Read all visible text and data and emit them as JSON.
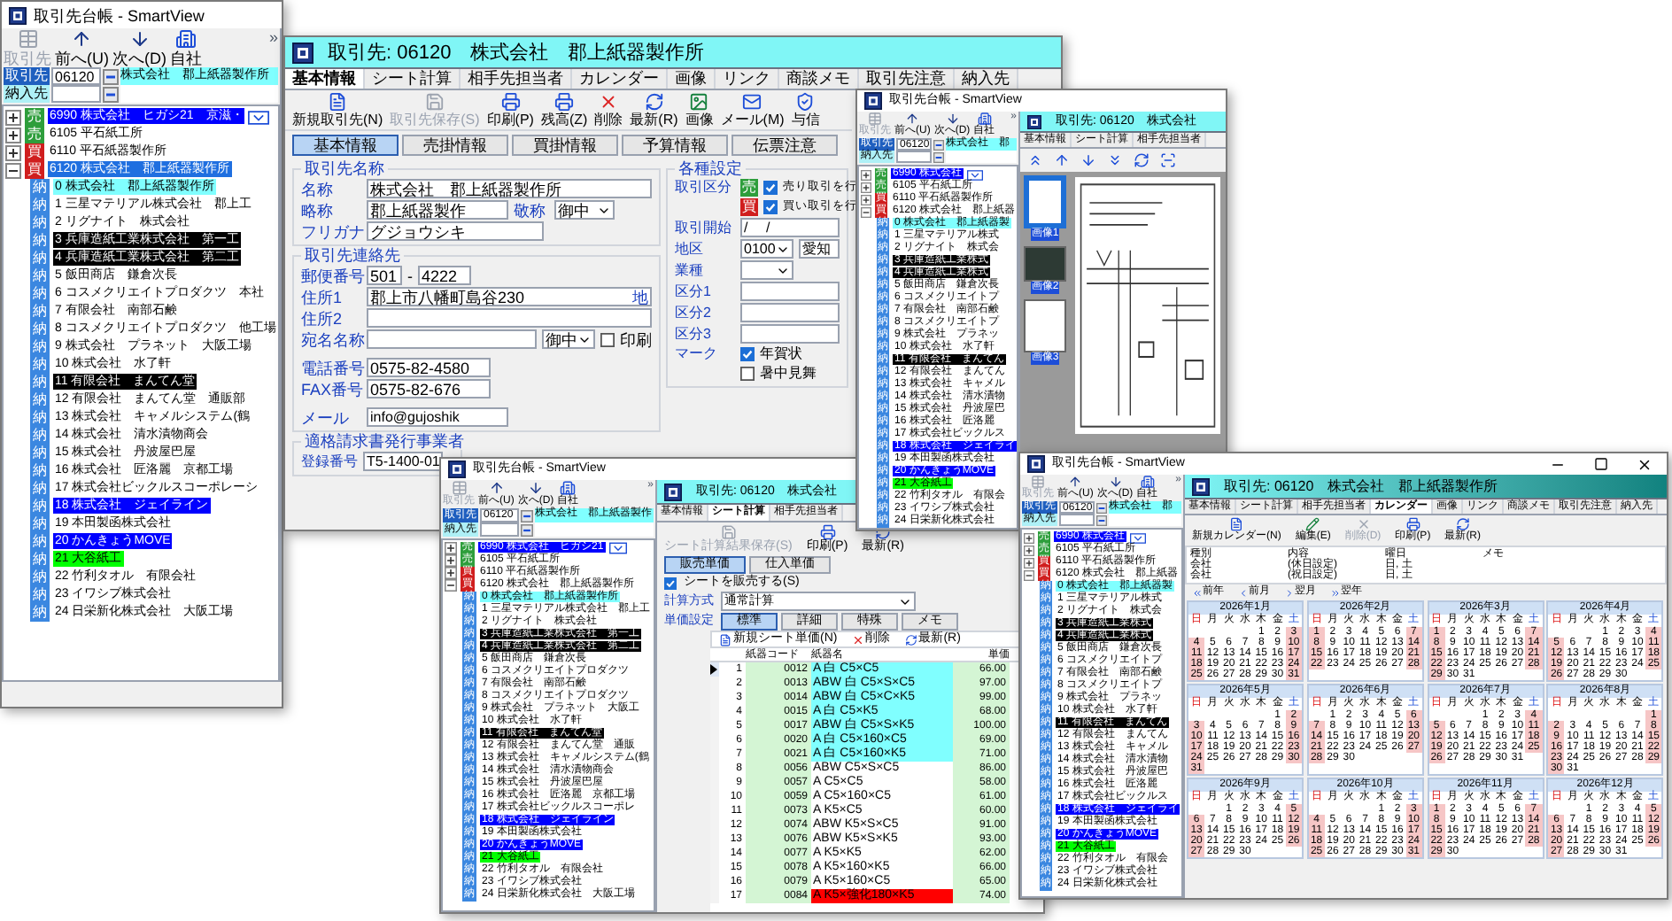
{
  "w1": {
    "title": "取引先台帳 - SmartView",
    "toolbar": [
      {
        "kind": "list",
        "label": "取引先",
        "disabled": true
      },
      {
        "kind": "up",
        "label": "前へ(U)",
        "disabled": false
      },
      {
        "kind": "down",
        "label": "次へ(D)",
        "disabled": false
      },
      {
        "kind": "company",
        "label": "自社",
        "disabled": false
      }
    ],
    "chevron": "»",
    "fields": [
      {
        "kind": "customer",
        "label": "取引先",
        "code": "06120",
        "name": "株式会社　郡上紙器製作所"
      },
      {
        "kind": "delivery",
        "label": "納入先"
      }
    ],
    "tree": [
      {
        "kind": "sell",
        "badge": "売",
        "label": "6990 株式会社　ヒガシ21　京滋・",
        "color": "#0000ff",
        "has_button": true,
        "expanded": false
      },
      {
        "kind": "sell",
        "badge": "売",
        "label": "6105 平石紙工所",
        "expanded": false
      },
      {
        "kind": "trade",
        "badge": "買",
        "label": "6110 平石紙器製作所",
        "expanded": false
      },
      {
        "kind": "trade",
        "badge": "買",
        "label": "6120 株式会社　郡上紙器製作所",
        "color": "#1f6fe0",
        "expanded": true,
        "children": [
          {
            "kind": "delivery",
            "badge": "納",
            "label": "0 株式会社　郡上紙器製作所",
            "color": "#80ffff"
          },
          {
            "kind": "delivery",
            "badge": "納",
            "label": "1 三星マテリアル株式会社　郡上工"
          },
          {
            "kind": "delivery",
            "badge": "納",
            "label": "2 リグナイト　株式会社"
          },
          {
            "kind": "delivery",
            "badge": "納",
            "label": "3 兵庫造紙工業株式会社　第一工",
            "color": "#000000"
          },
          {
            "kind": "delivery",
            "badge": "納",
            "label": "4 兵庫造紙工業株式会社　第二工",
            "color": "#000000"
          },
          {
            "kind": "delivery",
            "badge": "納",
            "label": "5 飯田商店　鎌倉次長"
          },
          {
            "kind": "delivery",
            "badge": "納",
            "label": "6 コスメクリエイトプロダクツ　本社"
          },
          {
            "kind": "delivery",
            "badge": "納",
            "label": "7 有限会社　南部石鹸"
          },
          {
            "kind": "delivery",
            "badge": "納",
            "label": "8 コスメクリエイトプロダクツ　他工場"
          },
          {
            "kind": "delivery",
            "badge": "納",
            "label": "9 株式会社　プラネット　大阪工場"
          },
          {
            "kind": "delivery",
            "badge": "納",
            "label": "10 株式会社　水了軒"
          },
          {
            "kind": "delivery",
            "badge": "納",
            "label": "11 有限会社　まんてん堂",
            "color": "#000000"
          },
          {
            "kind": "delivery",
            "badge": "納",
            "label": "12 有限会社　まんてん堂　通販部"
          },
          {
            "kind": "delivery",
            "badge": "納",
            "label": "13 株式会社　キャメルシステム(鶴"
          },
          {
            "kind": "delivery",
            "badge": "納",
            "label": "14 株式会社　清水漬物商会"
          },
          {
            "kind": "delivery",
            "badge": "納",
            "label": "15 株式会社　丹波屋巴屋"
          },
          {
            "kind": "delivery",
            "badge": "納",
            "label": "16 株式会社　匠洛麗　京都工場"
          },
          {
            "kind": "delivery",
            "badge": "納",
            "label": "17 株式会社ビックルスコーポレーシ"
          },
          {
            "kind": "delivery",
            "badge": "納",
            "label": "18 株式会社　ジェイライン",
            "color": "#0000ff"
          },
          {
            "kind": "delivery",
            "badge": "納",
            "label": "19 本田製函株式会社"
          },
          {
            "kind": "delivery",
            "badge": "納",
            "label": "20 かんきょうMOVE",
            "color": "#0000ff"
          },
          {
            "kind": "delivery",
            "badge": "納",
            "label": "21 大谷紙工",
            "color": "#00ff00"
          },
          {
            "kind": "delivery",
            "badge": "納",
            "label": "22 竹利タオル　有限会社"
          },
          {
            "kind": "delivery",
            "badge": "納",
            "label": "23 イワシブ株式会社"
          },
          {
            "kind": "delivery",
            "badge": "納",
            "label": "24 日栄新化株式会社　大阪工場"
          }
        ]
      }
    ]
  },
  "w2": {
    "header": "取引先: 06120　株式会社　郡上紙器製作所",
    "tabs": [
      {
        "label": "基本情報",
        "selected": true
      },
      {
        "label": "シート計算",
        "selected": false
      },
      {
        "label": "相手先担当者",
        "selected": false
      },
      {
        "label": "カレンダー",
        "selected": false
      },
      {
        "label": "画像",
        "selected": false
      },
      {
        "label": "リンク",
        "selected": false
      },
      {
        "label": "商談メモ",
        "selected": false
      },
      {
        "label": "取引先注意",
        "selected": false
      },
      {
        "label": "納入先",
        "selected": false
      }
    ],
    "toolbar": [
      {
        "kind": "new",
        "label": "新規取引先(N)",
        "disabled": false
      },
      {
        "kind": "save",
        "label": "取引先保存(S)",
        "disabled": true
      },
      {
        "kind": "print",
        "label": "印刷(P)",
        "disabled": false
      },
      {
        "kind": "print",
        "label": "残高(Z)",
        "disabled": false
      },
      {
        "kind": "delete",
        "label": "削除",
        "disabled": false
      },
      {
        "kind": "refresh",
        "label": "最新(R)",
        "disabled": false
      },
      {
        "kind": "image",
        "label": "画像",
        "disabled": false
      },
      {
        "kind": "mail",
        "label": "メール(M)",
        "disabled": false
      },
      {
        "kind": "credit",
        "label": "与信",
        "disabled": false
      }
    ],
    "subtabs": [
      {
        "label": "基本情報",
        "selected": true
      },
      {
        "label": "売掛情報",
        "selected": false
      },
      {
        "label": "買掛情報",
        "selected": false
      },
      {
        "label": "予算情報",
        "selected": false
      },
      {
        "label": "伝票注意",
        "selected": false
      }
    ],
    "name_group": {
      "title": "取引先名称",
      "name_label": "名称",
      "name": "株式会社　郡上紙器製作所",
      "short_label": "略称",
      "short": "郡上紙器製作",
      "honor_label": "敬称",
      "honor": "御中",
      "kana_label": "フリガナ",
      "kana": "グジョウシキ"
    },
    "contact_group": {
      "title": "取引先連絡先",
      "zip_label": "郵便番号",
      "zip1": "501",
      "zip_sep": "-",
      "zip2": "4222",
      "addr1_label": "住所1",
      "addr1": "郡上市八幡町島谷230",
      "map_button": "地",
      "addr2_label": "住所2",
      "addressee_label": "宛名名称",
      "addressee_honor": "御中",
      "print_label": "印刷",
      "print_checked": false,
      "tel_label": "電話番号",
      "tel": "0575-82-4580",
      "fax_label": "FAX番号",
      "fax": "0575-82-676",
      "mail_label": "メール",
      "mail": "info@gujoshik"
    },
    "invoice_group": {
      "title": "適格請求書発行事業者",
      "reg_label": "登録番号",
      "reg": "T5-1400-01"
    },
    "settings_group": {
      "title": "各種設定",
      "trade_label": "取引区分",
      "trades": [
        {
          "kind": "sell",
          "badge": "売",
          "label": "売り取引を行",
          "checked": true
        },
        {
          "kind": "trade",
          "badge": "買",
          "label": "買い取引を行",
          "checked": true
        }
      ],
      "start_label": "取引開始",
      "start": "/　 /",
      "area_label": "地区",
      "area_code": "0100",
      "area_name": "愛知",
      "industry_label": "業種",
      "divisions": [
        "区分1",
        "区分2",
        "区分3"
      ],
      "mark_label": "マーク",
      "marks": [
        {
          "label": "年賀状",
          "checked": true
        },
        {
          "label": "暑中見舞",
          "checked": false
        }
      ]
    }
  },
  "w3": {
    "title": "取引先台帳 - SmartView",
    "toolbar": [
      {
        "kind": "list",
        "label": "取引先",
        "disabled": true
      },
      {
        "kind": "up",
        "label": "前へ(U)",
        "disabled": false
      },
      {
        "kind": "down",
        "label": "次へ(D)",
        "disabled": false
      },
      {
        "kind": "company",
        "label": "自社",
        "disabled": false
      }
    ],
    "chevron": "»",
    "fields": [
      {
        "kind": "customer",
        "label": "取引先",
        "code": "06120",
        "name": "株式会社　郡上紙器製作"
      },
      {
        "kind": "delivery",
        "label": "納入先"
      }
    ],
    "tree": [
      {
        "kind": "sell",
        "badge": "売",
        "label": "6990 株式会社　ヒガシ21",
        "color": "#0000ff",
        "has_button": true,
        "expanded": false
      },
      {
        "kind": "sell",
        "badge": "売",
        "label": "6105 平石紙工所",
        "expanded": false
      },
      {
        "kind": "trade",
        "badge": "買",
        "label": "6110 平石紙器製作所",
        "expanded": false
      },
      {
        "kind": "trade",
        "badge": "買",
        "label": "6120 株式会社　郡上紙器製作所",
        "expanded": true,
        "children": [
          {
            "kind": "delivery",
            "badge": "納",
            "label": "0 株式会社　郡上紙器製作所",
            "color": "#80ffff"
          },
          {
            "kind": "delivery",
            "badge": "納",
            "label": "1 三星マテリアル株式会社　郡上工"
          },
          {
            "kind": "delivery",
            "badge": "納",
            "label": "2 リグナイト　株式会社"
          },
          {
            "kind": "delivery",
            "badge": "納",
            "label": "3 兵庫造紙工業株式会社　第一工",
            "color": "#000000"
          },
          {
            "kind": "delivery",
            "badge": "納",
            "label": "4 兵庫造紙工業株式会社　第二工",
            "color": "#000000"
          },
          {
            "kind": "delivery",
            "badge": "納",
            "label": "5 飯田商店　鎌倉次長"
          },
          {
            "kind": "delivery",
            "badge": "納",
            "label": "6 コスメクリエイトプロダクツ"
          },
          {
            "kind": "delivery",
            "badge": "納",
            "label": "7 有限会社　南部石鹸"
          },
          {
            "kind": "delivery",
            "badge": "納",
            "label": "8 コスメクリエイトプロダクツ"
          },
          {
            "kind": "delivery",
            "badge": "納",
            "label": "9 株式会社　プラネット　大阪工"
          },
          {
            "kind": "delivery",
            "badge": "納",
            "label": "10 株式会社　水了軒"
          },
          {
            "kind": "delivery",
            "badge": "納",
            "label": "11 有限会社　まんてん堂",
            "color": "#000000"
          },
          {
            "kind": "delivery",
            "badge": "納",
            "label": "12 有限会社　まんてん堂　通販"
          },
          {
            "kind": "delivery",
            "badge": "納",
            "label": "13 株式会社　キャメルシステム(鶴"
          },
          {
            "kind": "delivery",
            "badge": "納",
            "label": "14 株式会社　清水漬物商会"
          },
          {
            "kind": "delivery",
            "badge": "納",
            "label": "15 株式会社　丹波屋巴屋"
          },
          {
            "kind": "delivery",
            "badge": "納",
            "label": "16 株式会社　匠洛麗　京都工場"
          },
          {
            "kind": "delivery",
            "badge": "納",
            "label": "17 株式会社ビックルスコーポレ"
          },
          {
            "kind": "delivery",
            "badge": "納",
            "label": "18 株式会社　ジェイライン",
            "color": "#0000ff"
          },
          {
            "kind": "delivery",
            "badge": "納",
            "label": "19 本田製函株式会社"
          },
          {
            "kind": "delivery",
            "badge": "納",
            "label": "20 かんきょうMOVE",
            "color": "#0000ff"
          },
          {
            "kind": "delivery",
            "badge": "納",
            "label": "21 大谷紙工",
            "color": "#00ff00"
          },
          {
            "kind": "delivery",
            "badge": "納",
            "label": "22 竹利タオル　有限会社"
          },
          {
            "kind": "delivery",
            "badge": "納",
            "label": "23 イワシブ株式会社"
          },
          {
            "kind": "delivery",
            "badge": "納",
            "label": "24 日栄新化株式会社　大阪工場"
          }
        ]
      }
    ],
    "header": "取引先: 06120　株式会社",
    "tabs": [
      {
        "label": "基本情報",
        "selected": false
      },
      {
        "label": "シート計算",
        "selected": true
      },
      {
        "label": "相手先担当者",
        "selected": false
      }
    ],
    "toolbar2": [
      {
        "kind": "save",
        "label": "シート計算結果保存(S)",
        "disabled": true
      },
      {
        "kind": "print",
        "label": "印刷(P)",
        "disabled": false
      },
      {
        "kind": "refresh",
        "label": "最新(R)",
        "disabled": false
      }
    ],
    "subtabs": [
      {
        "label": "販売単価",
        "selected": true
      },
      {
        "label": "仕入単価",
        "selected": false
      }
    ],
    "sell_check": {
      "label": "シートを販売する(S)",
      "checked": true
    },
    "calc_label": "計算方式",
    "calc_value": "通常計算",
    "price_label": "単価設定",
    "price_tabs": [
      {
        "label": "標準",
        "selected": true
      },
      {
        "label": "詳細",
        "selected": false
      },
      {
        "label": "特殊",
        "selected": false
      },
      {
        "label": "メモ",
        "selected": false
      }
    ],
    "table_toolbar": [
      {
        "kind": "new",
        "label": "新規シート単価(N)",
        "disabled": false
      },
      {
        "kind": "delete",
        "label": "削除",
        "disabled": false
      },
      {
        "kind": "refresh",
        "label": "最新(R)",
        "disabled": false
      }
    ],
    "columns": [
      "紙器コード",
      "紙器名",
      "単価"
    ],
    "rows": [
      {
        "no": "1",
        "code": "0012",
        "name": "A 白 C5×C5",
        "price": "66.00",
        "color": "#80ffff",
        "selected": true
      },
      {
        "no": "2",
        "code": "0013",
        "name": "ABW 白 C5×S×C5",
        "price": "97.00",
        "color": "#80ffff",
        "selected": false
      },
      {
        "no": "3",
        "code": "0014",
        "name": "ABW 白 C5×C×K5",
        "price": "99.00",
        "color": "#80ffff",
        "selected": false
      },
      {
        "no": "4",
        "code": "0015",
        "name": "A 白 C5×K5",
        "price": "68.00",
        "color": "#80ffff",
        "selected": false
      },
      {
        "no": "5",
        "code": "0017",
        "name": "ABW 白 C5×S×K5",
        "price": "100.00",
        "color": "#80ffff",
        "selected": false
      },
      {
        "no": "6",
        "code": "0020",
        "name": "A 白 C5×160×C5",
        "price": "69.00",
        "color": "#80ffff",
        "selected": false
      },
      {
        "no": "7",
        "code": "0021",
        "name": "A 白 C5×160×K5",
        "price": "71.00",
        "color": "#80ffff",
        "selected": false
      },
      {
        "no": "8",
        "code": "0056",
        "name": "ABW C5×S×C5",
        "price": "86.00",
        "selected": false
      },
      {
        "no": "9",
        "code": "0057",
        "name": "A C5×C5",
        "price": "58.00",
        "selected": false
      },
      {
        "no": "10",
        "code": "0059",
        "name": "A C5×160×C5",
        "price": "61.00",
        "selected": false
      },
      {
        "no": "11",
        "code": "0073",
        "name": "A K5×C5",
        "price": "60.00",
        "selected": false
      },
      {
        "no": "12",
        "code": "0074",
        "name": "ABW K5×S×C5",
        "price": "91.00",
        "selected": false
      },
      {
        "no": "13",
        "code": "0076",
        "name": "ABW K5×S×K5",
        "price": "93.00",
        "selected": false
      },
      {
        "no": "14",
        "code": "0077",
        "name": "A K5×K5",
        "price": "62.00",
        "selected": false
      },
      {
        "no": "15",
        "code": "0078",
        "name": "A K5×160×K5",
        "price": "66.00",
        "selected": false
      },
      {
        "no": "16",
        "code": "0079",
        "name": "A K5×160×C5",
        "price": "65.00",
        "selected": false
      },
      {
        "no": "17",
        "code": "0084",
        "name": "A K5×強化180×K5",
        "price": "74.00",
        "color": "#ff0000",
        "selected": false
      }
    ]
  },
  "w4": {
    "title": "取引先台帳 - SmartView",
    "toolbar": [
      {
        "kind": "list",
        "label": "取引先",
        "disabled": true
      },
      {
        "kind": "up",
        "label": "前へ(U)",
        "disabled": false
      },
      {
        "kind": "down",
        "label": "次へ(D)",
        "disabled": false
      },
      {
        "kind": "company",
        "label": "自社",
        "disabled": false
      }
    ],
    "chevron": "»",
    "fields": [
      {
        "kind": "customer",
        "label": "取引先",
        "code": "06120",
        "name": "株式会社　郡"
      },
      {
        "kind": "delivery",
        "label": "納入先"
      }
    ],
    "tree": [
      {
        "kind": "sell",
        "badge": "売",
        "label": "6990 株式会社",
        "color": "#0000ff",
        "has_button": true,
        "expanded": false
      },
      {
        "kind": "sell",
        "badge": "売",
        "label": "6105 平石紙工所",
        "expanded": false
      },
      {
        "kind": "trade",
        "badge": "買",
        "label": "6110 平石紙器製作所",
        "expanded": false
      },
      {
        "kind": "trade",
        "badge": "買",
        "label": "6120 株式会社　郡上紙器",
        "expanded": true,
        "children": [
          {
            "kind": "delivery",
            "badge": "納",
            "label": "0 株式会社　郡上紙器製",
            "color": "#80ffff"
          },
          {
            "kind": "delivery",
            "badge": "納",
            "label": "1 三星マテリアル株式"
          },
          {
            "kind": "delivery",
            "badge": "納",
            "label": "2 リグナイト　株式会"
          },
          {
            "kind": "delivery",
            "badge": "納",
            "label": "3 兵庫造紙工業株式",
            "color": "#000000"
          },
          {
            "kind": "delivery",
            "badge": "納",
            "label": "4 兵庫造紙工業株式",
            "color": "#000000"
          },
          {
            "kind": "delivery",
            "badge": "納",
            "label": "5 飯田商店　鎌倉次長"
          },
          {
            "kind": "delivery",
            "badge": "納",
            "label": "6 コスメクリエイトプ"
          },
          {
            "kind": "delivery",
            "badge": "納",
            "label": "7 有限会社　南部石鹸"
          },
          {
            "kind": "delivery",
            "badge": "納",
            "label": "8 コスメクリエイトプ"
          },
          {
            "kind": "delivery",
            "badge": "納",
            "label": "9 株式会社　プラネッ"
          },
          {
            "kind": "delivery",
            "badge": "納",
            "label": "10 株式会社　水了軒"
          },
          {
            "kind": "delivery",
            "badge": "納",
            "label": "11 有限会社　まんてん",
            "color": "#000000"
          },
          {
            "kind": "delivery",
            "badge": "納",
            "label": "12 有限会社　まんてん"
          },
          {
            "kind": "delivery",
            "badge": "納",
            "label": "13 株式会社　キャメル"
          },
          {
            "kind": "delivery",
            "badge": "納",
            "label": "14 株式会社　清水漬物"
          },
          {
            "kind": "delivery",
            "badge": "納",
            "label": "15 株式会社　丹波屋巴"
          },
          {
            "kind": "delivery",
            "badge": "納",
            "label": "16 株式会社　匠洛麗"
          },
          {
            "kind": "delivery",
            "badge": "納",
            "label": "17 株式会社ビックルス"
          },
          {
            "kind": "delivery",
            "badge": "納",
            "label": "18 株式会社　ジェイライ",
            "color": "#0000ff"
          },
          {
            "kind": "delivery",
            "badge": "納",
            "label": "19 本田製函株式会社"
          },
          {
            "kind": "delivery",
            "badge": "納",
            "label": "20 かんきょうMOVE",
            "color": "#0000ff"
          },
          {
            "kind": "delivery",
            "badge": "納",
            "label": "21 大谷紙工",
            "color": "#00ff00"
          },
          {
            "kind": "delivery",
            "badge": "納",
            "label": "22 竹利タオル　有限会"
          },
          {
            "kind": "delivery",
            "badge": "納",
            "label": "23 イワシブ株式会社"
          },
          {
            "kind": "delivery",
            "badge": "納",
            "label": "24 日栄新化株式会社"
          }
        ]
      }
    ],
    "header": "取引先: 06120　株式会社",
    "tabs": [
      {
        "label": "基本情報",
        "selected": false
      },
      {
        "label": "シート計算",
        "selected": false
      },
      {
        "label": "相手先担当者",
        "selected": false
      }
    ],
    "thumbs": [
      {
        "kind": "document",
        "label": "画像1",
        "selected": true
      },
      {
        "kind": "photo",
        "label": "画像2",
        "selected": false
      },
      {
        "kind": "document",
        "label": "画像3",
        "selected": false
      }
    ]
  },
  "w5": {
    "title": "取引先台帳 - SmartView",
    "window_controls": true,
    "toolbar": [
      {
        "kind": "list",
        "label": "取引先",
        "disabled": true
      },
      {
        "kind": "up",
        "label": "前へ(U)",
        "disabled": false
      },
      {
        "kind": "down",
        "label": "次へ(D)",
        "disabled": false
      },
      {
        "kind": "company",
        "label": "自社",
        "disabled": false
      }
    ],
    "chevron": "»",
    "fields": [
      {
        "kind": "customer",
        "label": "取引先",
        "code": "06120",
        "name": "株式会社　郡"
      },
      {
        "kind": "delivery",
        "label": "納入先"
      }
    ],
    "tree": [
      {
        "kind": "sell",
        "badge": "売",
        "label": "6990 株式会社",
        "color": "#0000ff",
        "has_button": true,
        "expanded": false
      },
      {
        "kind": "sell",
        "badge": "売",
        "label": "6105 平石紙工所",
        "expanded": false
      },
      {
        "kind": "trade",
        "badge": "買",
        "label": "6110 平石紙器製作所",
        "expanded": false
      },
      {
        "kind": "trade",
        "badge": "買",
        "label": "6120 株式会社　郡上紙器",
        "expanded": true,
        "children": [
          {
            "kind": "delivery",
            "badge": "納",
            "label": "0 株式会社　郡上紙器製",
            "color": "#80ffff"
          },
          {
            "kind": "delivery",
            "badge": "納",
            "label": "1 三星マテリアル株式"
          },
          {
            "kind": "delivery",
            "badge": "納",
            "label": "2 リグナイト　株式会"
          },
          {
            "kind": "delivery",
            "badge": "納",
            "label": "3 兵庫造紙工業株式",
            "color": "#000000"
          },
          {
            "kind": "delivery",
            "badge": "納",
            "label": "4 兵庫造紙工業株式",
            "color": "#000000"
          },
          {
            "kind": "delivery",
            "badge": "納",
            "label": "5 飯田商店　鎌倉次長"
          },
          {
            "kind": "delivery",
            "badge": "納",
            "label": "6 コスメクリエイトプ"
          },
          {
            "kind": "delivery",
            "badge": "納",
            "label": "7 有限会社　南部石鹸"
          },
          {
            "kind": "delivery",
            "badge": "納",
            "label": "8 コスメクリエイトプ"
          },
          {
            "kind": "delivery",
            "badge": "納",
            "label": "9 株式会社　プラネッ"
          },
          {
            "kind": "delivery",
            "badge": "納",
            "label": "10 株式会社　水了軒"
          },
          {
            "kind": "delivery",
            "badge": "納",
            "label": "11 有限会社　まんてん",
            "color": "#000000"
          },
          {
            "kind": "delivery",
            "badge": "納",
            "label": "12 有限会社　まんてん"
          },
          {
            "kind": "delivery",
            "badge": "納",
            "label": "13 株式会社　キャメル"
          },
          {
            "kind": "delivery",
            "badge": "納",
            "label": "14 株式会社　清水漬物"
          },
          {
            "kind": "delivery",
            "badge": "納",
            "label": "15 株式会社　丹波屋巴"
          },
          {
            "kind": "delivery",
            "badge": "納",
            "label": "16 株式会社　匠洛麗"
          },
          {
            "kind": "delivery",
            "badge": "納",
            "label": "17 株式会社ビックルス"
          },
          {
            "kind": "delivery",
            "badge": "納",
            "label": "18 株式会社　ジェイライ",
            "color": "#0000ff"
          },
          {
            "kind": "delivery",
            "badge": "納",
            "label": "19 本田製函株式会社"
          },
          {
            "kind": "delivery",
            "badge": "納",
            "label": "20 かんきょうMOVE",
            "color": "#0000ff"
          },
          {
            "kind": "delivery",
            "badge": "納",
            "label": "21 大谷紙工",
            "color": "#00ff00"
          },
          {
            "kind": "delivery",
            "badge": "納",
            "label": "22 竹利タオル　有限会"
          },
          {
            "kind": "delivery",
            "badge": "納",
            "label": "23 イワシブ株式会社"
          },
          {
            "kind": "delivery",
            "badge": "納",
            "label": "24 日栄新化株式会社"
          }
        ]
      }
    ],
    "header": "取引先: 06120　株式会社　郡上紙器製作所",
    "tabs": [
      {
        "label": "基本情報",
        "selected": false
      },
      {
        "label": "シート計算",
        "selected": false
      },
      {
        "label": "相手先担当者",
        "selected": false
      },
      {
        "label": "カレンダー",
        "selected": true
      },
      {
        "label": "画像",
        "selected": false
      },
      {
        "label": "リンク",
        "selected": false
      },
      {
        "label": "商談メモ",
        "selected": false
      },
      {
        "label": "取引先注意",
        "selected": false
      },
      {
        "label": "納入先",
        "selected": false
      }
    ],
    "toolbar2": [
      {
        "kind": "new",
        "label": "新規カレンダー(N)",
        "disabled": false
      },
      {
        "kind": "edit",
        "label": "編集(E)",
        "disabled": false
      },
      {
        "kind": "delete",
        "label": "削除(D)",
        "disabled": true
      },
      {
        "kind": "print",
        "label": "印刷(P)",
        "disabled": false
      },
      {
        "kind": "refresh",
        "label": "最新(R)",
        "disabled": false
      }
    ],
    "columns": [
      "種別",
      "内容",
      "曜日",
      "メモ"
    ],
    "rows": [
      [
        "会社",
        "(休日設定)",
        "日, 土"
      ],
      [
        "会社",
        "(祝日設定)",
        "日, 土"
      ]
    ],
    "nav": [
      {
        "kind": "prev2",
        "label": "前年"
      },
      {
        "kind": "prev",
        "label": "前月"
      },
      {
        "kind": "next",
        "label": "翌月"
      },
      {
        "kind": "next2",
        "label": "翌年"
      }
    ],
    "months": [
      {
        "title": "2026年1月",
        "weekdays": [
          "日",
          "月",
          "火",
          "水",
          "木",
          "金",
          "土"
        ],
        "weeks": [
          [
            "1",
            "2",
            "3"
          ],
          [
            "4",
            "5",
            "6",
            "7",
            "8",
            "9",
            "10"
          ],
          [
            "11",
            "12",
            "13",
            "14",
            "15",
            "16",
            "17"
          ],
          [
            "18",
            "19",
            "20",
            "21",
            "22",
            "23",
            "24"
          ],
          [
            "25",
            "26",
            "27",
            "28",
            "29",
            "30",
            "31"
          ]
        ]
      },
      {
        "title": "2026年2月",
        "weekdays": [
          "日",
          "月",
          "火",
          "水",
          "木",
          "金",
          "土"
        ],
        "weeks": [
          [
            "1",
            "2",
            "3",
            "4",
            "5",
            "6",
            "7"
          ],
          [
            "8",
            "9",
            "10",
            "11",
            "12",
            "13",
            "14"
          ],
          [
            "15",
            "16",
            "17",
            "18",
            "19",
            "20",
            "21"
          ],
          [
            "22",
            "23",
            "24",
            "25",
            "26",
            "27",
            "28"
          ]
        ]
      },
      {
        "title": "2026年3月",
        "weekdays": [
          "日",
          "月",
          "火",
          "水",
          "木",
          "金",
          "土"
        ],
        "weeks": [
          [
            "1",
            "2",
            "3",
            "4",
            "5",
            "6",
            "7"
          ],
          [
            "8",
            "9",
            "10",
            "11",
            "12",
            "13",
            "14"
          ],
          [
            "15",
            "16",
            "17",
            "18",
            "19",
            "20",
            "21"
          ],
          [
            "22",
            "23",
            "24",
            "25",
            "26",
            "27",
            "28"
          ],
          [
            "29",
            "30",
            "31"
          ]
        ]
      },
      {
        "title": "2026年4月",
        "weekdays": [
          "日",
          "月",
          "火",
          "水",
          "木",
          "金",
          "土"
        ],
        "weeks": [
          [
            "1",
            "2",
            "3",
            "4"
          ],
          [
            "5",
            "6",
            "7",
            "8",
            "9",
            "10",
            "11"
          ],
          [
            "12",
            "13",
            "14",
            "15",
            "16",
            "17",
            "18"
          ],
          [
            "19",
            "20",
            "21",
            "22",
            "23",
            "24",
            "25"
          ],
          [
            "26",
            "27",
            "28",
            "29",
            "30"
          ]
        ]
      },
      {
        "title": "2026年5月",
        "weekdays": [
          "日",
          "月",
          "火",
          "水",
          "木",
          "金",
          "土"
        ],
        "weeks": [
          [
            "1",
            "2"
          ],
          [
            "3",
            "4",
            "5",
            "6",
            "7",
            "8",
            "9"
          ],
          [
            "10",
            "11",
            "12",
            "13",
            "14",
            "15",
            "16"
          ],
          [
            "17",
            "18",
            "19",
            "20",
            "21",
            "22",
            "23"
          ],
          [
            "24",
            "25",
            "26",
            "27",
            "28",
            "29",
            "30"
          ],
          [
            "31"
          ]
        ]
      },
      {
        "title": "2026年6月",
        "weekdays": [
          "日",
          "月",
          "火",
          "水",
          "木",
          "金",
          "土"
        ],
        "weeks": [
          [
            "1",
            "2",
            "3",
            "4",
            "5",
            "6"
          ],
          [
            "7",
            "8",
            "9",
            "10",
            "11",
            "12",
            "13"
          ],
          [
            "14",
            "15",
            "16",
            "17",
            "18",
            "19",
            "20"
          ],
          [
            "21",
            "22",
            "23",
            "24",
            "25",
            "26",
            "27"
          ],
          [
            "28",
            "29",
            "30"
          ]
        ]
      },
      {
        "title": "2026年7月",
        "weekdays": [
          "日",
          "月",
          "火",
          "水",
          "木",
          "金",
          "土"
        ],
        "weeks": [
          [
            "1",
            "2",
            "3",
            "4"
          ],
          [
            "5",
            "6",
            "7",
            "8",
            "9",
            "10",
            "11"
          ],
          [
            "12",
            "13",
            "14",
            "15",
            "16",
            "17",
            "18"
          ],
          [
            "19",
            "20",
            "21",
            "22",
            "23",
            "24",
            "25"
          ],
          [
            "26",
            "27",
            "28",
            "29",
            "30",
            "31"
          ]
        ]
      },
      {
        "title": "2026年8月",
        "weekdays": [
          "日",
          "月",
          "火",
          "水",
          "木",
          "金",
          "土"
        ],
        "weeks": [
          [
            "1"
          ],
          [
            "2",
            "3",
            "4",
            "5",
            "6",
            "7",
            "8"
          ],
          [
            "9",
            "10",
            "11",
            "12",
            "13",
            "14",
            "15"
          ],
          [
            "16",
            "17",
            "18",
            "19",
            "20",
            "21",
            "22"
          ],
          [
            "23",
            "24",
            "25",
            "26",
            "27",
            "28",
            "29"
          ],
          [
            "30",
            "31"
          ]
        ]
      },
      {
        "title": "2026年9月",
        "weekdays": [
          "日",
          "月",
          "火",
          "水",
          "木",
          "金",
          "土"
        ],
        "weeks": [
          [
            "1",
            "2",
            "3",
            "4",
            "5"
          ],
          [
            "6",
            "7",
            "8",
            "9",
            "10",
            "11",
            "12"
          ],
          [
            "13",
            "14",
            "15",
            "16",
            "17",
            "18",
            "19"
          ],
          [
            "20",
            "21",
            "22",
            "23",
            "24",
            "25",
            "26"
          ],
          [
            "27",
            "28",
            "29",
            "30"
          ]
        ]
      },
      {
        "title": "2026年10月",
        "weekdays": [
          "日",
          "月",
          "火",
          "水",
          "木",
          "金",
          "土"
        ],
        "weeks": [
          [
            "1",
            "2",
            "3"
          ],
          [
            "4",
            "5",
            "6",
            "7",
            "8",
            "9",
            "10"
          ],
          [
            "11",
            "12",
            "13",
            "14",
            "15",
            "16",
            "17"
          ],
          [
            "18",
            "19",
            "20",
            "21",
            "22",
            "23",
            "24"
          ],
          [
            "25",
            "26",
            "27",
            "28",
            "29",
            "30",
            "31"
          ]
        ]
      },
      {
        "title": "2026年11月",
        "weekdays": [
          "日",
          "月",
          "火",
          "水",
          "木",
          "金",
          "土"
        ],
        "weeks": [
          [
            "1",
            "2",
            "3",
            "4",
            "5",
            "6",
            "7"
          ],
          [
            "8",
            "9",
            "10",
            "11",
            "12",
            "13",
            "14"
          ],
          [
            "15",
            "16",
            "17",
            "18",
            "19",
            "20",
            "21"
          ],
          [
            "22",
            "23",
            "24",
            "25",
            "26",
            "27",
            "28"
          ],
          [
            "29",
            "30"
          ]
        ]
      },
      {
        "title": "2026年12月",
        "weekdays": [
          "日",
          "月",
          "火",
          "水",
          "木",
          "金",
          "土"
        ],
        "weeks": [
          [
            "1",
            "2",
            "3",
            "4",
            "5"
          ],
          [
            "6",
            "7",
            "8",
            "9",
            "10",
            "11",
            "12"
          ],
          [
            "13",
            "14",
            "15",
            "16",
            "17",
            "18",
            "19"
          ],
          [
            "20",
            "21",
            "22",
            "23",
            "24",
            "25",
            "26"
          ],
          [
            "27",
            "28",
            "29",
            "30",
            "31"
          ]
        ]
      }
    ]
  }
}
